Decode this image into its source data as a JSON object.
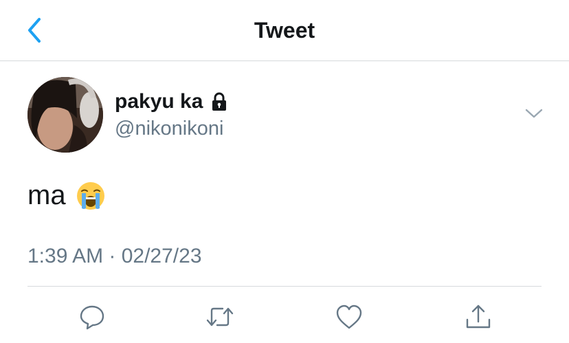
{
  "header": {
    "title": "Tweet",
    "back_icon": "chevron-left-icon"
  },
  "tweet": {
    "display_name": "pakyu ka",
    "username": "@nikonikoni",
    "protected_icon": "lock-icon",
    "text": "ma",
    "emoji": "loudly-crying-face",
    "timestamp": "1:39 AM · 02/27/23",
    "more_icon": "chevron-down-icon"
  },
  "actions": [
    {
      "name": "reply",
      "icon": "reply-icon"
    },
    {
      "name": "retweet",
      "icon": "retweet-icon"
    },
    {
      "name": "like",
      "icon": "heart-icon"
    },
    {
      "name": "share",
      "icon": "share-icon"
    }
  ],
  "colors": {
    "accent": "#1da1f2",
    "text": "#14171a",
    "secondary": "#657786",
    "icon": "#657786",
    "divider": "#d6d9dc"
  }
}
